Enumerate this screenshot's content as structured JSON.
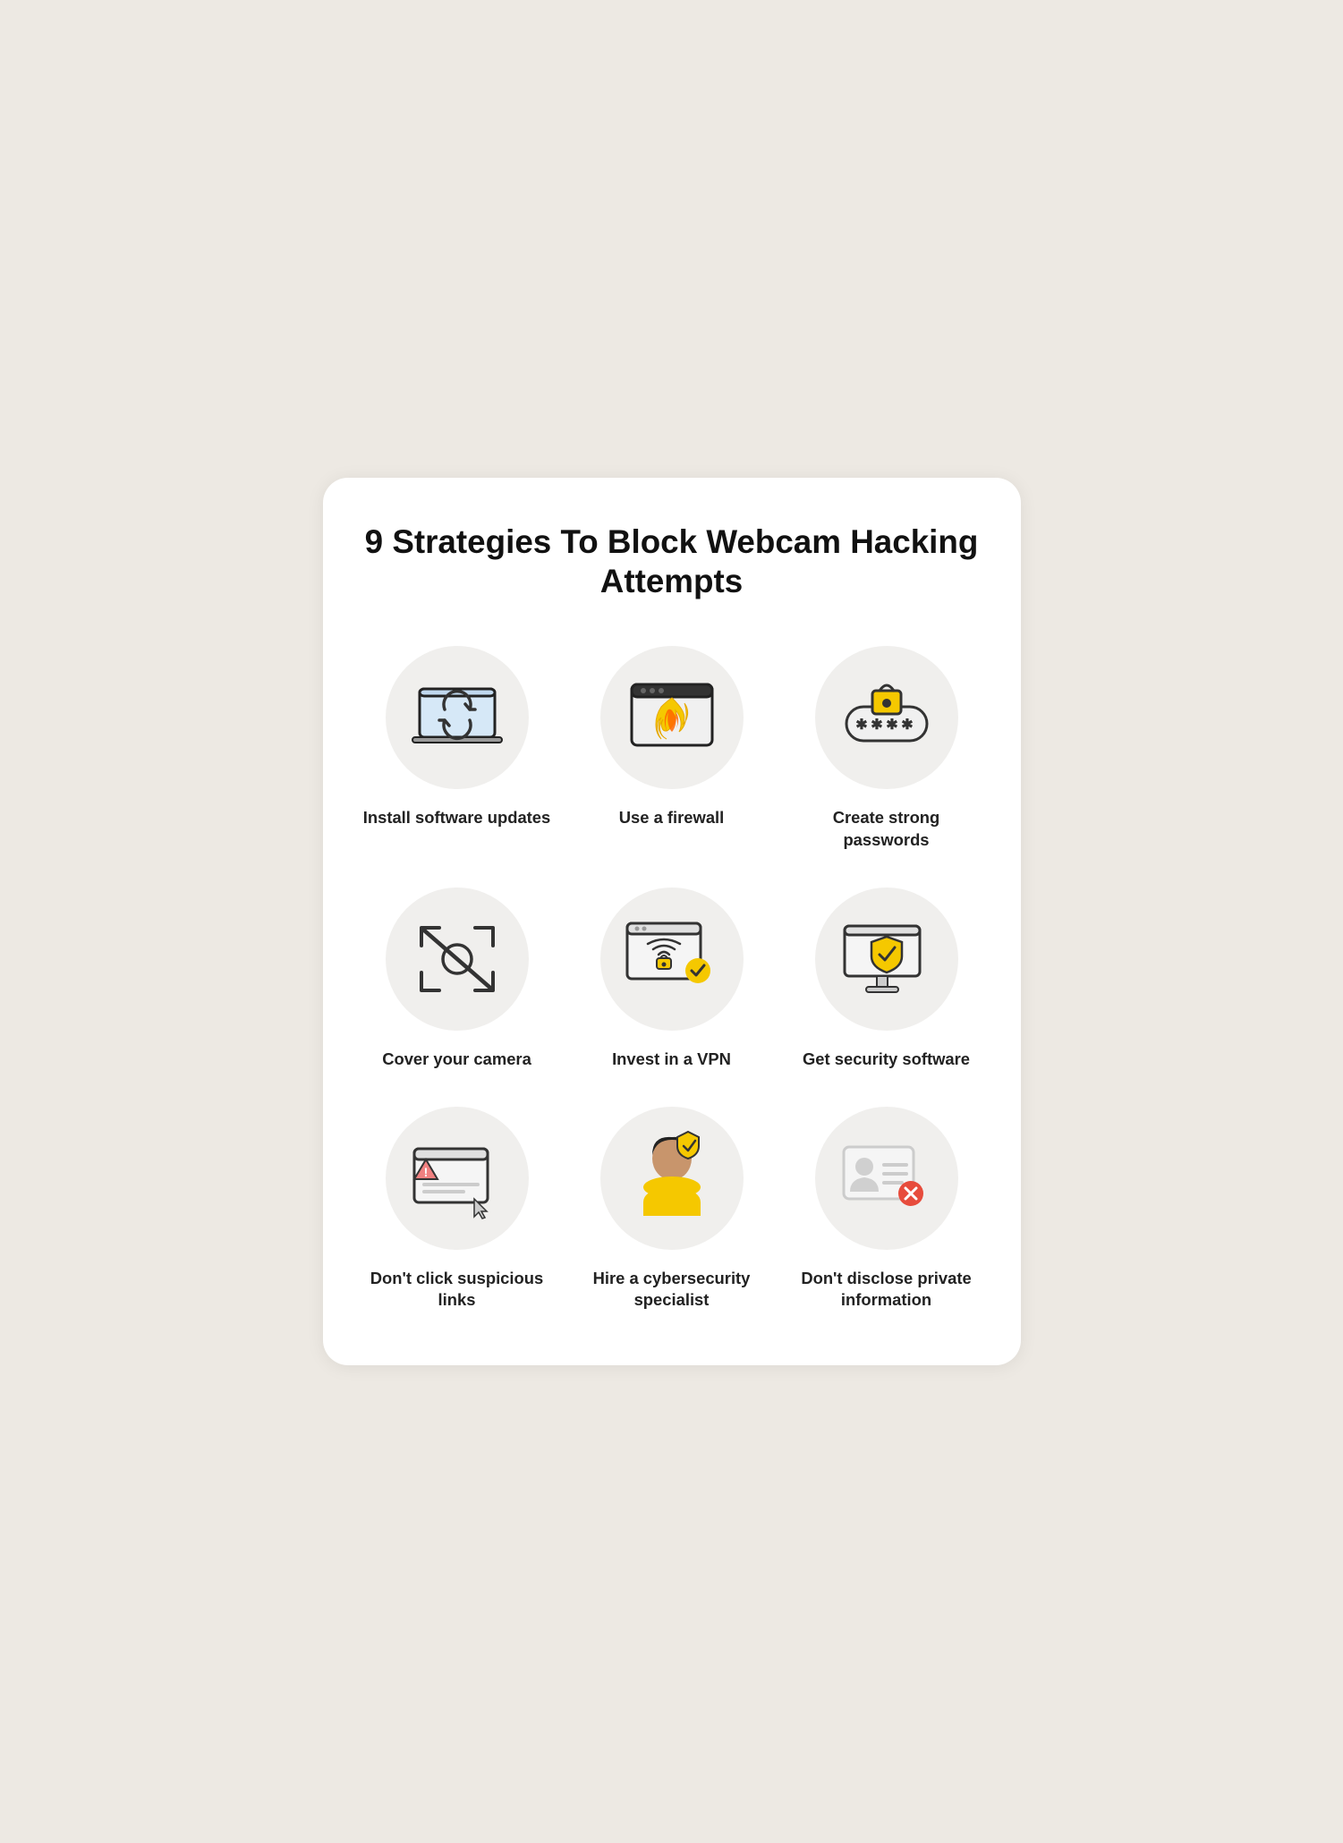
{
  "title": "9 Strategies To Block Webcam Hacking Attempts",
  "items": [
    {
      "id": "install-software-updates",
      "label": "Install software updates",
      "icon": "laptop-update"
    },
    {
      "id": "use-a-firewall",
      "label": "Use a firewall",
      "icon": "firewall"
    },
    {
      "id": "create-strong-passwords",
      "label": "Create strong passwords",
      "icon": "password"
    },
    {
      "id": "cover-your-camera",
      "label": "Cover your camera",
      "icon": "camera-off"
    },
    {
      "id": "invest-in-vpn",
      "label": "Invest in a VPN",
      "icon": "vpn"
    },
    {
      "id": "get-security-software",
      "label": "Get security software",
      "icon": "security-software"
    },
    {
      "id": "dont-click-suspicious-links",
      "label": "Don't click suspicious links",
      "icon": "suspicious-links"
    },
    {
      "id": "hire-cybersecurity-specialist",
      "label": "Hire a cybersecurity specialist",
      "icon": "cybersecurity-specialist"
    },
    {
      "id": "dont-disclose-private-information",
      "label": "Don't disclose private information",
      "icon": "private-info"
    }
  ]
}
